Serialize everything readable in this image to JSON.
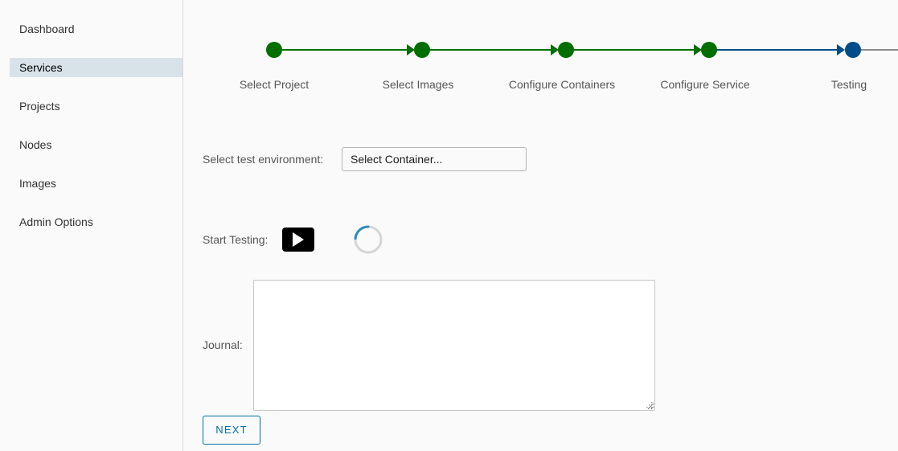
{
  "sidebar": {
    "items": [
      {
        "label": "Dashboard",
        "active": false
      },
      {
        "label": "Services",
        "active": true
      },
      {
        "label": "Projects",
        "active": false
      },
      {
        "label": "Nodes",
        "active": false
      },
      {
        "label": "Images",
        "active": false
      },
      {
        "label": "Admin Options",
        "active": false
      }
    ]
  },
  "stepper": {
    "steps": [
      {
        "label": "Select Project",
        "status": "complete"
      },
      {
        "label": "Select Images",
        "status": "complete"
      },
      {
        "label": "Configure Containers",
        "status": "complete"
      },
      {
        "label": "Configure Service",
        "status": "complete"
      },
      {
        "label": "Testing",
        "status": "current"
      }
    ],
    "colors": {
      "complete": "#006e00",
      "current": "#004d8a",
      "pending": "#8c8c8c"
    }
  },
  "form": {
    "environment_label": "Select test environment:",
    "environment_value": "Select Container...",
    "start_label": "Start Testing:",
    "start_icon": "play-icon",
    "spinner_icon": "loading-spinner-icon",
    "journal_label": "Journal:",
    "journal_value": "",
    "next_label": "NEXT"
  }
}
